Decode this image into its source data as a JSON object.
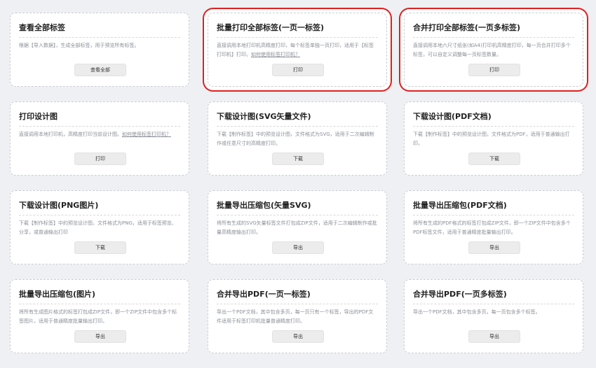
{
  "cards": [
    {
      "title": "查看全部标签",
      "desc": "根据【导入数据】，生成全部标签，用于预览所有标签。",
      "link": "",
      "button": "查看全部"
    },
    {
      "title": "批量打印全部标签(一页一标签)",
      "desc": "直接调用本地打印机高精度打印，每个标签单独一页打印，适用于【标签打印机】打印。",
      "link": "如何使用标签打印机？",
      "button": "打印"
    },
    {
      "title": "合并打印全部标签(一页多标签)",
      "desc": "直接调用本地六尺寸纸张(如A4)打印机高精度打印，每一页合并打印多个标签，可以自定义调整每一页标签数量。",
      "link": "",
      "button": "打印"
    },
    {
      "title": "打印设计图",
      "desc": "直接调用本地打印机，高精度打印当前设计图。",
      "link": "如何使用标签打印机？",
      "button": "打印"
    },
    {
      "title": "下载设计图(SVG矢量文件)",
      "desc": "下载【制作标签】中的预览设计图，文件格式为SVG，适用于二次编辑制作或任意尺寸的高精度打印。",
      "link": "",
      "button": "下载"
    },
    {
      "title": "下载设计图(PDF文档)",
      "desc": "下载【制作标签】中的预览设计图，文件格式为PDF，适用于普通输出打印。",
      "link": "",
      "button": "下载"
    },
    {
      "title": "下载设计图(PNG图片)",
      "desc": "下载【制作标签】中的预览设计图，文件格式为PNG，适用于标签预览、分享，或普通输出打印",
      "link": "",
      "button": "下载"
    },
    {
      "title": "批量导出压缩包(矢量SVG)",
      "desc": "将所有生成的SVG矢量标签文件打包成ZIP文件，适用于二次编辑制作或批量高精度输出打印。",
      "link": "",
      "button": "导出"
    },
    {
      "title": "批量导出压缩包(PDF文档)",
      "desc": "将所有生成的PDF格式的标签打包成ZIP文件，即一个ZIP文件中包含多个PDF标签文件，适用于普通精度批量输出打印。",
      "link": "",
      "button": "导出"
    },
    {
      "title": "批量导出压缩包(图片)",
      "desc": "将所有生成图片格式的标签打包成ZIP文件，即一个ZIP文件中包含多个标签图片，适用于普通精度批量输出打印。",
      "link": "",
      "button": "导出"
    },
    {
      "title": "合并导出PDF(一页一标签)",
      "desc": "导出一个PDF文档，其中包含多页，每一页只有一个标签，导出的PDF文件适用于标签打印机批量普通精度打印。",
      "link": "",
      "button": "导出"
    },
    {
      "title": "合并导出PDF(一页多标签)",
      "desc": "导出一个PDF文档，其中包含多页，每一页包含多个标签。",
      "link": "",
      "button": "导出"
    }
  ]
}
